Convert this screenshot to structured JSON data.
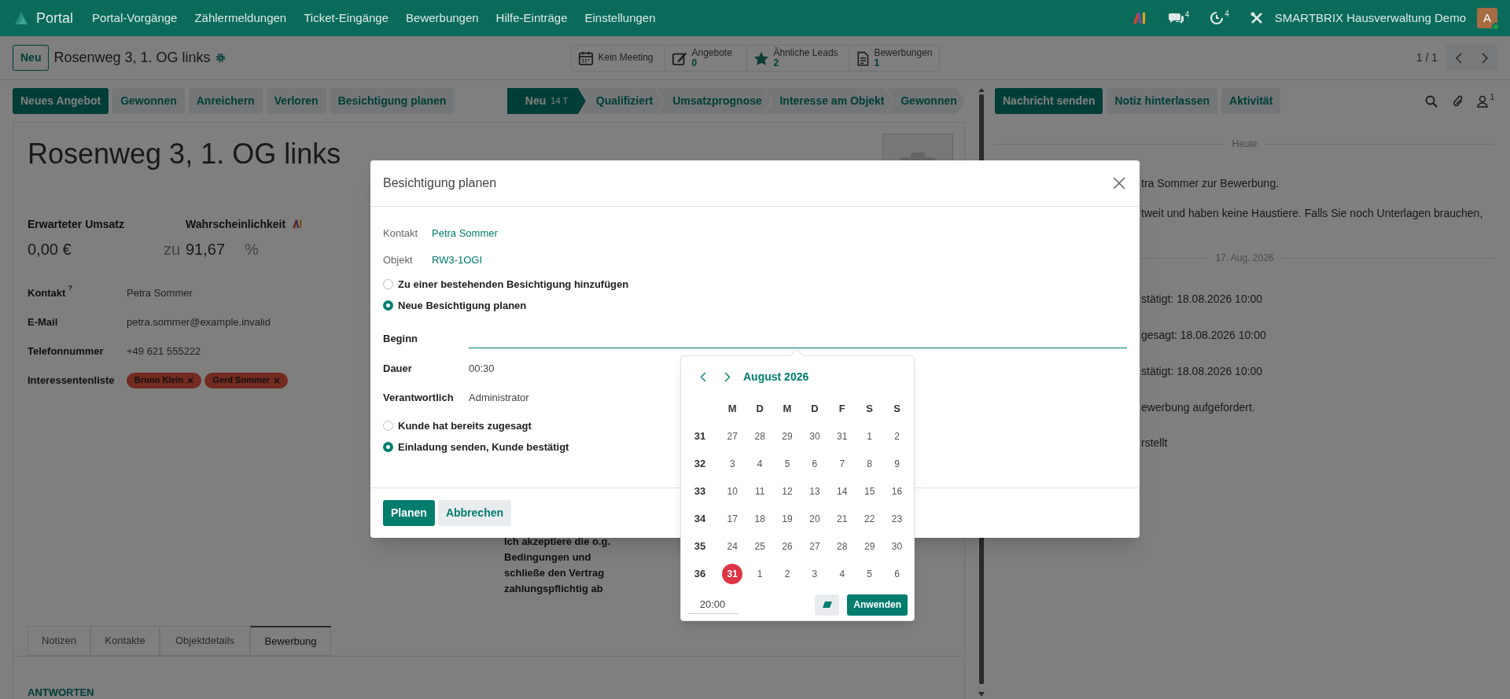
{
  "navbar": {
    "app": "Portal",
    "menu": [
      "Portal-Vorgänge",
      "Zählermeldungen",
      "Ticket-Eingänge",
      "Bewerbungen",
      "Hilfe-Einträge",
      "Einstellungen"
    ],
    "messages_count": "4",
    "activities_count": "4",
    "company": "SMARTBRIX Hausverwaltung Demo",
    "avatar": "A"
  },
  "control_panel": {
    "new_button": "Neu",
    "breadcrumb": "Rosenweg 3, 1. OG links",
    "pager": "1 / 1",
    "smart_buttons": [
      {
        "label": "Kein Meeting"
      },
      {
        "label": "Angebote",
        "value": "0"
      },
      {
        "label": "Ähnliche Leads",
        "value": "2"
      },
      {
        "label": "Bewerbungen",
        "value": "1"
      }
    ]
  },
  "actions": [
    {
      "label": "Neues Angebot",
      "kind": "primary"
    },
    {
      "label": "Gewonnen",
      "kind": "secondary"
    },
    {
      "label": "Anreichern",
      "kind": "secondary"
    },
    {
      "label": "Verloren",
      "kind": "secondary"
    },
    {
      "label": "Besichtigung planen",
      "kind": "secondary"
    }
  ],
  "stages": [
    {
      "label": "Neu",
      "badge": "14 T",
      "selected": true
    },
    {
      "label": "Qualifiziert",
      "selected": false
    },
    {
      "label": "Umsatzprognose",
      "selected": false
    },
    {
      "label": "Interesse am Objekt",
      "selected": false
    },
    {
      "label": "Gewonnen",
      "selected": false
    }
  ],
  "form": {
    "title": "Rosenweg 3, 1. OG links",
    "revenue_label": "Erwarteter Umsatz",
    "revenue": "0,00 €",
    "probability_label": "Wahrscheinlichkeit",
    "probability_prefix": "zu",
    "probability": "91,67",
    "probability_unit": "%",
    "fields": [
      {
        "label": "Kontakt",
        "help": "?",
        "value": "Petra Sommer"
      },
      {
        "label": "E-Mail",
        "value": "petra.sommer@example.invalid"
      },
      {
        "label": "Telefonnummer",
        "value": "+49 621 555222"
      },
      {
        "label": "Interessentenliste",
        "tags": [
          "Bruno Klein",
          "Gerd Sommer"
        ]
      }
    ],
    "agreement": "Ich akzeptiere die o.g. Bedingungen und schließe den Vertrag zahlungspflichtig ab",
    "tabs": [
      {
        "label": "Notizen",
        "selected": false
      },
      {
        "label": "Kontakte",
        "selected": false
      },
      {
        "label": "Objektdetails",
        "selected": false
      },
      {
        "label": "Bewerbung",
        "selected": true
      }
    ],
    "section_title": "ANTWORTEN"
  },
  "chatter": {
    "buttons": [
      {
        "label": "Nachricht senden",
        "kind": "primary"
      },
      {
        "label": "Notiz hinterlassen",
        "kind": "secondary"
      },
      {
        "label": "Aktivität",
        "kind": "secondary"
      }
    ],
    "followers_count": "1",
    "items": [
      {
        "kind": "separator",
        "text": "Heute"
      },
      {
        "kind": "text",
        "text": "tra Sommer zur Bewerbung."
      },
      {
        "kind": "text",
        "text": "tweit und haben keine Haustiere. Falls Sie noch Unterlagen brauchen,"
      },
      {
        "kind": "separator",
        "text": "17. Aug. 2026"
      },
      {
        "kind": "text",
        "text": "stätigt: 18.08.2026 10:00"
      },
      {
        "kind": "text",
        "text": "gesagt: 18.08.2026 10:00"
      },
      {
        "kind": "text",
        "text": "stätigt: 18.08.2026 10:00"
      },
      {
        "kind": "text",
        "text": "ewerbung aufgefordert."
      },
      {
        "kind": "text",
        "text": "rstellt"
      }
    ]
  },
  "dialog": {
    "title": "Besichtigung planen",
    "contact_label": "Kontakt",
    "contact": "Petra Sommer",
    "object_label": "Objekt",
    "object": "RW3-1OGI",
    "mode_options": [
      {
        "label": "Zu einer bestehenden Besichtigung hinzufügen",
        "checked": false
      },
      {
        "label": "Neue Besichtigung planen",
        "checked": true
      }
    ],
    "start_label": "Beginn",
    "duration_label": "Dauer",
    "duration": "00:30",
    "responsible_label": "Verantwortlich",
    "responsible": "Administrator",
    "confirm_options": [
      {
        "label": "Kunde hat bereits zugesagt",
        "checked": false
      },
      {
        "label": "Einladung senden, Kunde bestätigt",
        "checked": true
      }
    ],
    "buttons": [
      {
        "label": "Planen",
        "kind": "primary"
      },
      {
        "label": "Abbrechen",
        "kind": "secondary"
      }
    ]
  },
  "datepicker": {
    "month": "August 2026",
    "weekdays": [
      "M",
      "D",
      "M",
      "D",
      "F",
      "S",
      "S"
    ],
    "time": "20:00",
    "apply": "Anwenden",
    "weeks": [
      {
        "week": "31",
        "days": [
          {
            "label": "27",
            "selected": false
          },
          {
            "label": "28",
            "selected": false
          },
          {
            "label": "29",
            "selected": false
          },
          {
            "label": "30",
            "selected": false
          },
          {
            "label": "31",
            "selected": false
          },
          {
            "label": "1",
            "selected": false
          },
          {
            "label": "2",
            "selected": false
          }
        ]
      },
      {
        "week": "32",
        "days": [
          {
            "label": "3",
            "selected": false
          },
          {
            "label": "4",
            "selected": false
          },
          {
            "label": "5",
            "selected": false
          },
          {
            "label": "6",
            "selected": false
          },
          {
            "label": "7",
            "selected": false
          },
          {
            "label": "8",
            "selected": false
          },
          {
            "label": "9",
            "selected": false
          }
        ]
      },
      {
        "week": "33",
        "days": [
          {
            "label": "10",
            "selected": false
          },
          {
            "label": "11",
            "selected": false
          },
          {
            "label": "12",
            "selected": false
          },
          {
            "label": "13",
            "selected": false
          },
          {
            "label": "14",
            "selected": false
          },
          {
            "label": "15",
            "selected": false
          },
          {
            "label": "16",
            "selected": false
          }
        ]
      },
      {
        "week": "34",
        "days": [
          {
            "label": "17",
            "selected": false
          },
          {
            "label": "18",
            "selected": false
          },
          {
            "label": "19",
            "selected": false
          },
          {
            "label": "20",
            "selected": false
          },
          {
            "label": "21",
            "selected": false
          },
          {
            "label": "22",
            "selected": false
          },
          {
            "label": "23",
            "selected": false
          }
        ]
      },
      {
        "week": "35",
        "days": [
          {
            "label": "24",
            "selected": false
          },
          {
            "label": "25",
            "selected": false
          },
          {
            "label": "26",
            "selected": false
          },
          {
            "label": "27",
            "selected": false
          },
          {
            "label": "28",
            "selected": false
          },
          {
            "label": "29",
            "selected": false
          },
          {
            "label": "30",
            "selected": false
          }
        ]
      },
      {
        "week": "36",
        "days": [
          {
            "label": "31",
            "selected": true
          },
          {
            "label": "1",
            "selected": false
          },
          {
            "label": "2",
            "selected": false
          },
          {
            "label": "3",
            "selected": false
          },
          {
            "label": "4",
            "selected": false
          },
          {
            "label": "5",
            "selected": false
          },
          {
            "label": "6",
            "selected": false
          }
        ]
      }
    ]
  }
}
